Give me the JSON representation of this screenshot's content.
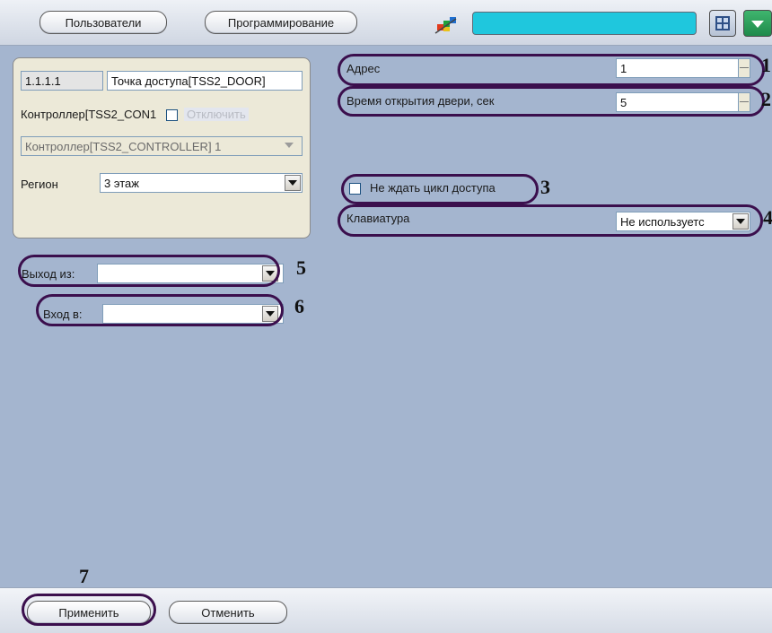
{
  "toolbar": {
    "users_button": "Пользователи",
    "programming_button": "Программирование",
    "tool_icon": "wand-paint-icon",
    "search_value": "",
    "grid_icon": "grid-icon",
    "dropdown_icon": "chevron-down-icon"
  },
  "object_panel": {
    "id": "1.1.1.1",
    "name": "Точка доступа[TSS2_DOOR]",
    "controller_label": "Контроллер[TSS2_CON1",
    "disable_label": "Отключить",
    "parent_controller": "Контроллер[TSS2_CONTROLLER] 1",
    "region_label": "Регион",
    "region_value": "3 этаж"
  },
  "settings": {
    "address_label": "Адрес",
    "address_value": "1",
    "door_open_label": "Время открытия двери, сек",
    "door_open_value": "5",
    "no_wait_label": "Не ждать цикл доступа",
    "keyboard_label": "Клавиатура",
    "keyboard_value": "Не используетс"
  },
  "zones": {
    "exit_label": "Выход из:",
    "exit_value": "",
    "enter_label": "Вход в:",
    "enter_value": ""
  },
  "footer": {
    "apply_button": "Применить",
    "cancel_button": "Отменить"
  },
  "annotations": {
    "m1": "1",
    "m2": "2",
    "m3": "3",
    "m4": "4",
    "m5": "5",
    "m6": "6",
    "m7": "7"
  },
  "colors": {
    "workspace_bg": "#a4b5cf",
    "accent_cyan": "#1fc7dd",
    "annotation_oval": "#3b0f4d"
  }
}
